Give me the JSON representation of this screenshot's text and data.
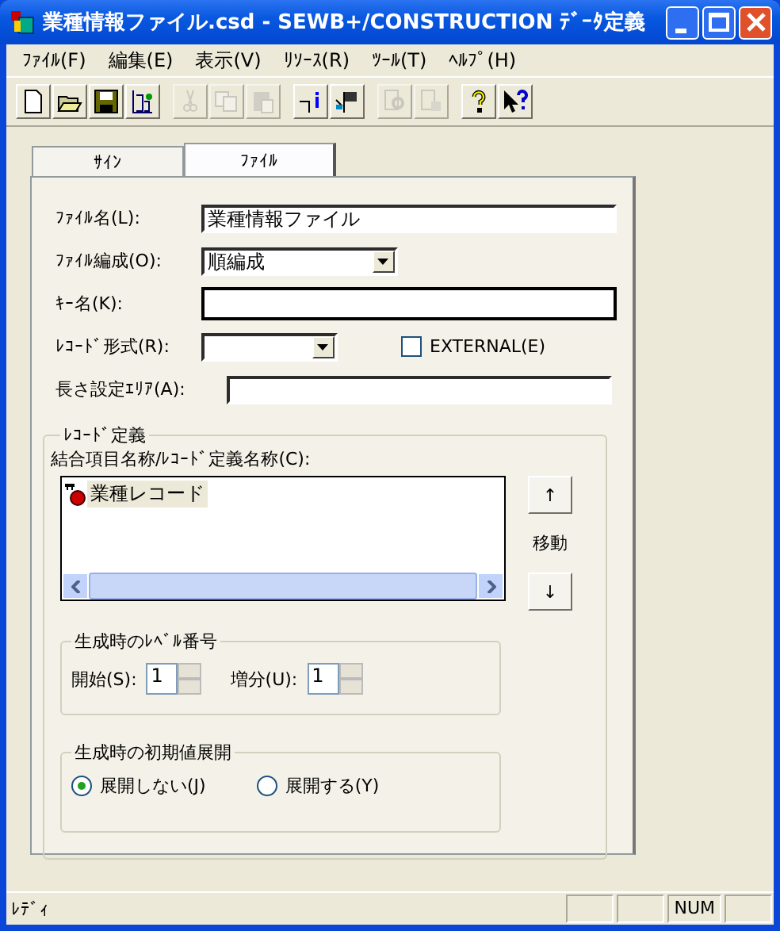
{
  "window": {
    "title": "業種情報ファイル.csd - SEWB+/CONSTRUCTION ﾃﾞｰﾀ定義"
  },
  "menu": [
    "ﾌｧｲﾙ(F)",
    "編集(E)",
    "表示(V)",
    "ﾘｿｰｽ(R)",
    "ﾂｰﾙ(T)",
    "ﾍﾙﾌﾟ(H)"
  ],
  "toolbar": [
    {
      "buttons": [
        {
          "kind": "new",
          "disabled": false
        },
        {
          "kind": "open",
          "disabled": false
        },
        {
          "kind": "save",
          "disabled": false
        },
        {
          "kind": "build",
          "disabled": false
        }
      ]
    },
    {
      "buttons": [
        {
          "kind": "cut",
          "disabled": true
        },
        {
          "kind": "copy",
          "disabled": true
        },
        {
          "kind": "paste",
          "disabled": true
        }
      ]
    },
    {
      "buttons": [
        {
          "kind": "info",
          "disabled": false
        },
        {
          "kind": "import",
          "disabled": false
        }
      ]
    },
    {
      "buttons": [
        {
          "kind": "find",
          "disabled": true
        },
        {
          "kind": "replace",
          "disabled": true
        }
      ]
    },
    {
      "buttons": [
        {
          "kind": "help",
          "disabled": false
        },
        {
          "kind": "context-help",
          "disabled": false
        }
      ]
    }
  ],
  "tabs": [
    {
      "label": "ｻｲﾝ",
      "selected": false
    },
    {
      "label": "ﾌｧｲﾙ",
      "selected": true
    }
  ],
  "form": {
    "file_name": {
      "label": "ﾌｧｲﾙ名(L):",
      "value": "業種情報ファイル"
    },
    "file_organization": {
      "label": "ﾌｧｲﾙ編成(O):",
      "value": "順編成"
    },
    "key_name": {
      "label": "ｷｰ名(K):"
    },
    "record_format": {
      "label": "ﾚｺｰﾄﾞ形式(R):"
    },
    "external": {
      "label": "EXTERNAL(E)",
      "checked": false
    },
    "length_area": {
      "label": "長さ設定ｴﾘｱ(A):"
    }
  },
  "record_definition": {
    "title": "ﾚｺｰﾄﾞ定義",
    "list_label": "結合項目名称/ﾚｺｰﾄﾞ定義名称(C):",
    "items": [
      {
        "label": "業種レコード",
        "selected": true
      }
    ],
    "move_up": "↑",
    "move_label": "移動",
    "move_down": "↓"
  },
  "level_number": {
    "title": "生成時のﾚﾍﾞﾙ番号",
    "start": {
      "label": "開始(S):",
      "value": "1"
    },
    "increment": {
      "label": "増分(U):",
      "value": "1"
    }
  },
  "initial_value": {
    "title": "生成時の初期値展開",
    "options": [
      {
        "label": "展開しない(J)",
        "selected": true
      },
      {
        "label": "展開する(Y)",
        "selected": false
      }
    ]
  },
  "status_bar": {
    "text": "ﾚﾃﾞｨ",
    "panes": [
      "NUM"
    ]
  }
}
